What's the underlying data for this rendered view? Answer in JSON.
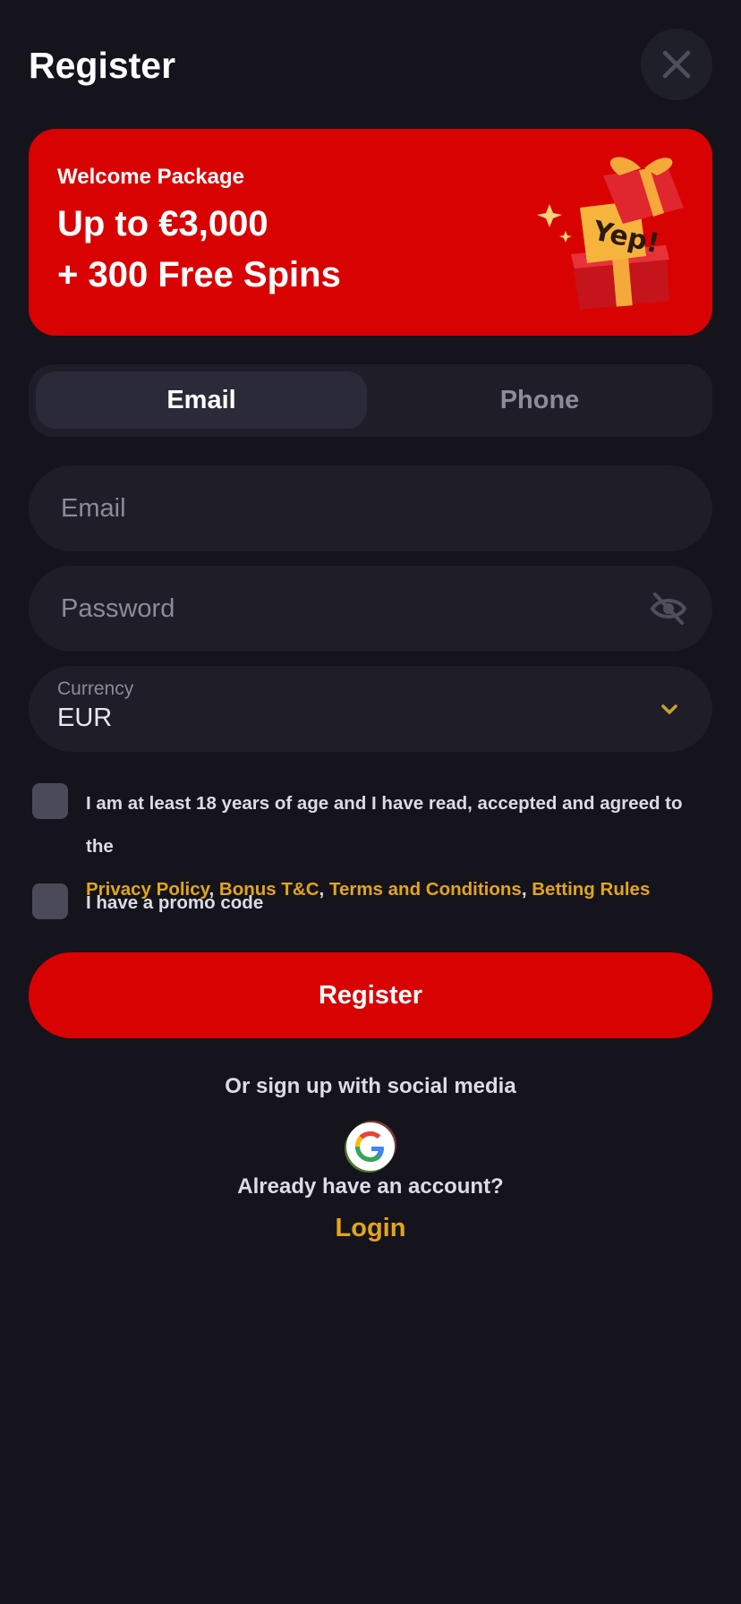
{
  "header": {
    "title": "Register",
    "close_icon": "close-icon"
  },
  "banner": {
    "subtitle": "Welcome Package",
    "line1": "Up to €3,000",
    "line2": "+ 300 Free Spins",
    "gift_text": "Yep!",
    "background_color": "#d90202"
  },
  "tabs": [
    {
      "label": "Email",
      "active": true
    },
    {
      "label": "Phone",
      "active": false
    }
  ],
  "form": {
    "email": {
      "placeholder": "Email",
      "value": ""
    },
    "password": {
      "placeholder": "Password",
      "value": "",
      "icon": "eye-off-icon"
    },
    "currency": {
      "label": "Currency",
      "value": "EUR",
      "icon": "chevron-down-icon"
    }
  },
  "consent": {
    "text": "I am at least 18 years of age and I have read, accepted and agreed to the",
    "links": [
      "Privacy Policy",
      "Bonus T&C",
      "Terms and Conditions",
      "Betting Rules"
    ],
    "separator": ","
  },
  "promo": {
    "label": "I have a promo code"
  },
  "register_button": {
    "label": "Register"
  },
  "social": {
    "text": "Or sign up with social media",
    "providers": [
      "google-icon"
    ]
  },
  "login": {
    "prompt": "Already have an account?",
    "link": "Login"
  },
  "colors": {
    "accent": "#d90202",
    "link": "#e2a51c",
    "background": "#15141d"
  }
}
